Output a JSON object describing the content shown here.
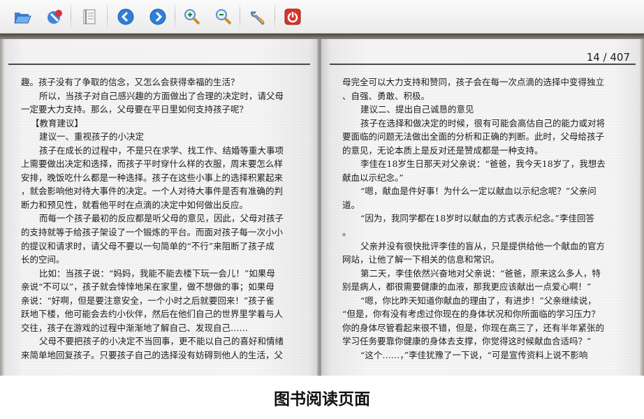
{
  "toolbar": {
    "buttons": [
      {
        "icon": "open-folder-icon"
      },
      {
        "icon": "bookmark-pin-icon"
      },
      {
        "icon": "table-of-contents-icon"
      },
      {
        "icon": "previous-page-icon"
      },
      {
        "icon": "next-page-icon"
      },
      {
        "icon": "zoom-in-icon"
      },
      {
        "icon": "zoom-out-icon"
      },
      {
        "icon": "settings-wrench-icon"
      },
      {
        "icon": "power-exit-icon"
      }
    ],
    "colors": {
      "nav_blue": "#2f7fd6",
      "exit_red": "#d9352b"
    }
  },
  "book": {
    "page_indicator": "14 / 407",
    "left_page": [
      "趣。孩子没有了争取的信念，又怎么会获得幸福的生活？",
      "所以，当孩子对自己感兴趣的方面做出了合理的决定时，请父母",
      "一定要大力支持。那么，父母要在平日里如何支持孩子呢？",
      "【教育建议】",
      "建议一、重视孩子的小决定",
      "孩子在成长的过程中，不是只在求学、找工作、结婚等重大事项",
      "上需要做出决定和选择，而孩子平时穿什么样的衣服，周末要怎么样",
      "安排，晚饭吃什么都是一种选择。孩子在这些小事上的选择积累起来",
      "，就会影响他对待大事件的决定。一个人对待大事件是否有准确的判",
      "断力和预见性，就看他平时在点滴的决定中如何做出反应。",
      "而每一个孩子最初的反应都是听父母的意见，因此，父母对孩子",
      "的支持就等于给孩子架设了一个锻炼的平台。而面对孩子每一次小小",
      "的提议和请求时，请父母不要以一句简单的“不行”来阻断了孩子成",
      "长的空间。",
      "比如：当孩子说：“妈妈，我能不能去楼下玩一会儿！”如果母",
      "亲说“不可以”，孩子就会悻悻地呆在家里，做不想做的事；如果母",
      "亲说：“好啊，但是要注意安全，一个小时之后就要回来！”孩子雀",
      "跃地下楼，他可能会去约小伙伴，然后在他们自己的世界里学着与人",
      "交往，孩子在游戏的过程中渐渐地了解自己、发现自己……",
      "父母不要把孩子的小决定不当回事，更不能以自己的喜好和情绪",
      "来简单地回复孩子。只要孩子自己的选择没有妨碍到他人的生活，父"
    ],
    "right_page": [
      "母完全可以大力支持和赞同，孩子会在每一次点滴的选择中变得独立",
      "、自强、勇敢、积极。",
      "建议二、提出自己诚恳的意见",
      "孩子在选择和做决定的时候，很有可能会高估自己的能力或对将",
      "要面临的问题无法做出全面的分析和正确的判断。此时，父母给孩子",
      "的意见，无论本质上是反对还是赞成都是一种支持。",
      "李佳在18岁生日那天对父亲说：“爸爸，我今天18岁了，我想去",
      "献血以示纪念。”",
      "“嗯，献血是件好事！为什么一定以献血以示纪念呢？”父亲问",
      "道。",
      "“因为，我同学都在18岁时以献血的方式表示纪念。”李佳回答",
      "。",
      "父亲并没有很快批评李佳的盲从，只是提供给他一个献血的官方",
      "网站，让他了解一下相关的信息和常识。",
      "第二天，李佳依然兴奋地对父亲说：“爸爸，原来这么多人，特",
      "别是病人，都很需要健康的血液，那我更应该献出一点爱心啊！”",
      "“嗯，你比昨天知道你献血的理由了，有进步！”父亲继续说，",
      "“但是，你有没有考虑过你现在的身体状况和你所面临的学习压力？",
      "你的身体尽管看起来很不错，但是，你现在高三了，还有半年紧张的",
      "学习任务要靠你健康的身体去支撑，你觉得这时候献血合适吗？”",
      "“这个……，”李佳犹豫了一下说，“可是宣传资料上说不影响"
    ]
  },
  "caption": "图书阅读页面"
}
